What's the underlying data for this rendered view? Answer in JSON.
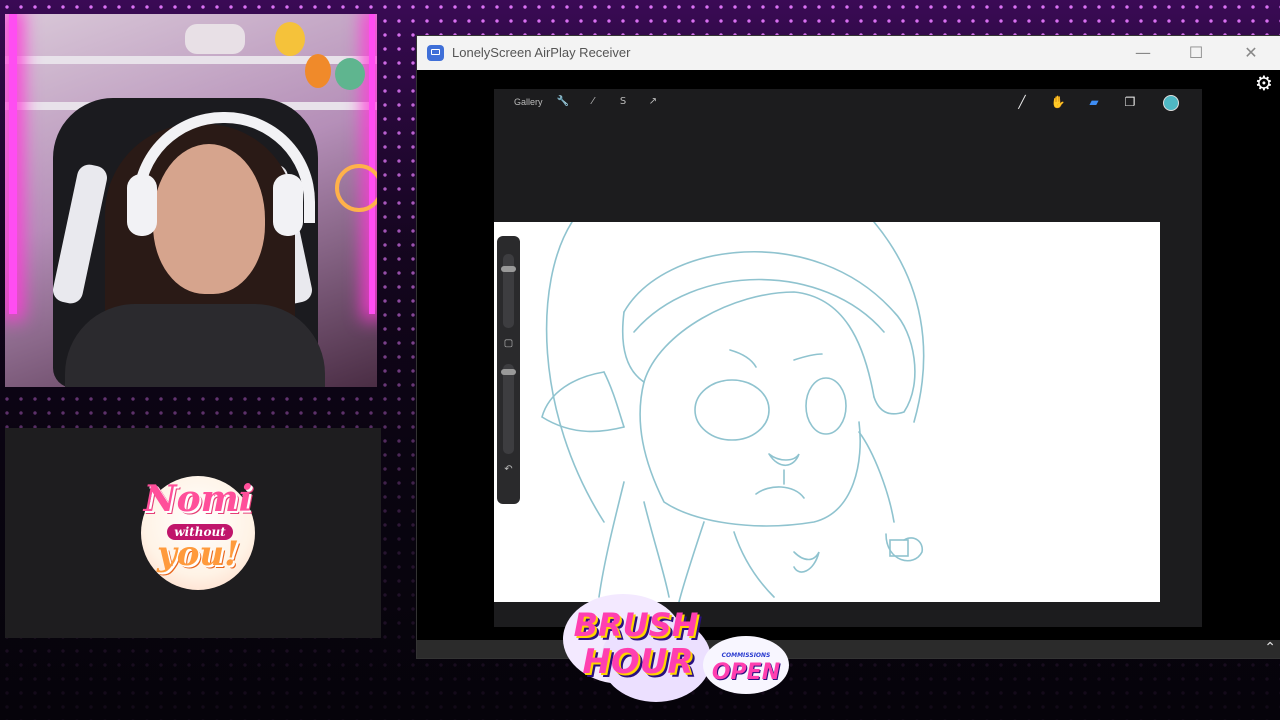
{
  "window": {
    "title": "LonelyScreen AirPlay Receiver",
    "minimize_icon": "minimize-icon",
    "maximize_icon": "maximize-icon",
    "close_icon": "close-icon",
    "settings_icon": "gear-icon"
  },
  "procreate": {
    "gallery_label": "Gallery",
    "left_tools": [
      "wrench-icon",
      "magic-wand-icon",
      "selection-icon",
      "transform-icon"
    ],
    "right_tools": [
      "brush-icon",
      "smudge-icon",
      "eraser-icon",
      "layers-icon"
    ],
    "active_color": "#4fb8c4",
    "sidebar_icons": [
      "modify-square-icon",
      "undo-icon"
    ]
  },
  "overlay": {
    "logo_line1": "Nomi",
    "logo_line2": "without",
    "logo_line3": "you!",
    "brush_line1": "BRUSH",
    "brush_line2": "HOUR",
    "commissions": "COMMISSIONS",
    "open": "OPEN"
  },
  "colors": {
    "sketch": "#8fc3cf",
    "neon": "#ff3ad8",
    "accent_pink": "#ff3fb0"
  }
}
